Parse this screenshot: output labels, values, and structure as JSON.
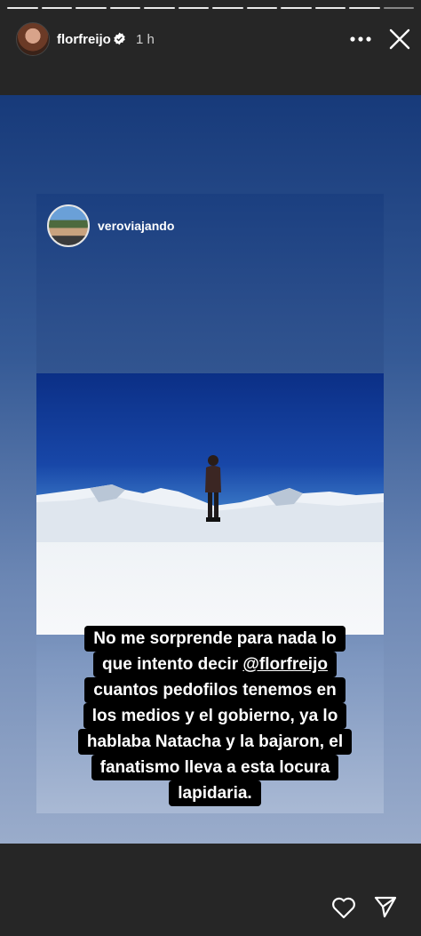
{
  "header": {
    "username": "florfreijo",
    "time": "1 h",
    "progress_segments": 12
  },
  "shared_post": {
    "username": "veroviajando"
  },
  "caption": {
    "lines": [
      "No me sorprende para nada lo",
      "que intento decir ",
      "cuantos pedofilos tenemos en",
      "los medios y el gobierno, ya lo",
      "hablaba Natacha y la bajaron, el",
      "fanatismo lleva a esta locura",
      "lapidaria."
    ],
    "mention": "@florfreijo"
  },
  "icons": {
    "verified": "verified-badge-icon",
    "more": "more-options-icon",
    "close": "close-icon",
    "like": "heart-icon",
    "share": "send-icon"
  }
}
